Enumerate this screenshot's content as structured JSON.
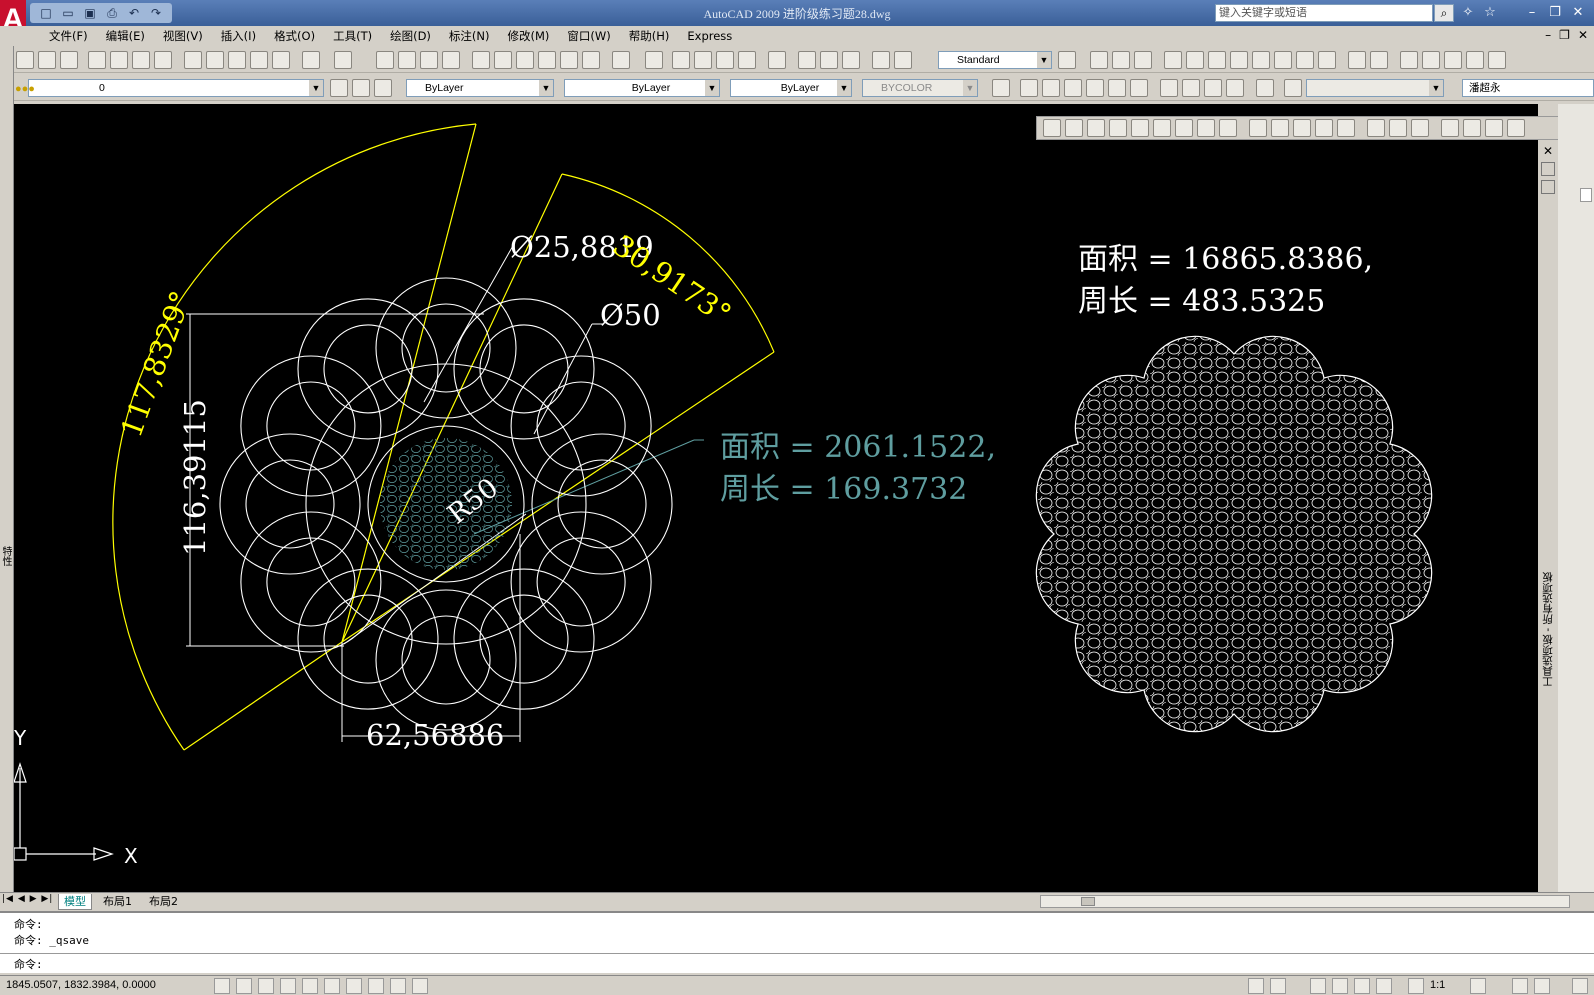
{
  "title_bar": {
    "app_title": "AutoCAD 2009 进阶级练习题28.dwg",
    "search_placeholder": "键入关键字或短语"
  },
  "menus": [
    "文件(F)",
    "编辑(E)",
    "视图(V)",
    "插入(I)",
    "格式(O)",
    "工具(T)",
    "绘图(D)",
    "标注(N)",
    "修改(M)",
    "窗口(W)",
    "帮助(H)",
    "Express"
  ],
  "toolbar": {
    "text_style": "Standard",
    "text_style_value": "潘超永",
    "layer": "0",
    "color": "ByLayer",
    "linetype": "ByLayer",
    "lineweight": "ByLayer",
    "plotstyle": "BYCOLOR"
  },
  "drawing": {
    "dim_diameter_small": "Ø25,8819",
    "dim_angle_small": "30,9173°",
    "dim_diameter_large": "Ø50",
    "dim_angle_large": "117,8329°",
    "dim_vertical": "116,39115",
    "dim_radius": "R50",
    "dim_horizontal": "62,56886",
    "small_area": "面积 = 2061.1522,",
    "small_perimeter": "周长 = 169.3732",
    "large_area": "面积 = 16865.8386,",
    "large_perimeter": "周长 = 483.5325",
    "ucs_x": "X",
    "ucs_y": "Y"
  },
  "palette": {
    "vertical_label": "工具选项板 - 所有选项板",
    "properties_label": "特性"
  },
  "tabs": [
    "模型",
    "布局1",
    "布局2"
  ],
  "command": {
    "line1": "命令:",
    "line2": "命令: _qsave",
    "prompt": "命令:"
  },
  "status": {
    "coords": "1845.0507, 1832.3984, 0.0000",
    "scale": "1:1"
  },
  "colors": {
    "background": "#000000",
    "geometry": "#ffffff",
    "dimension_angle": "#ffff00",
    "hatch": "#5f9ea0"
  }
}
